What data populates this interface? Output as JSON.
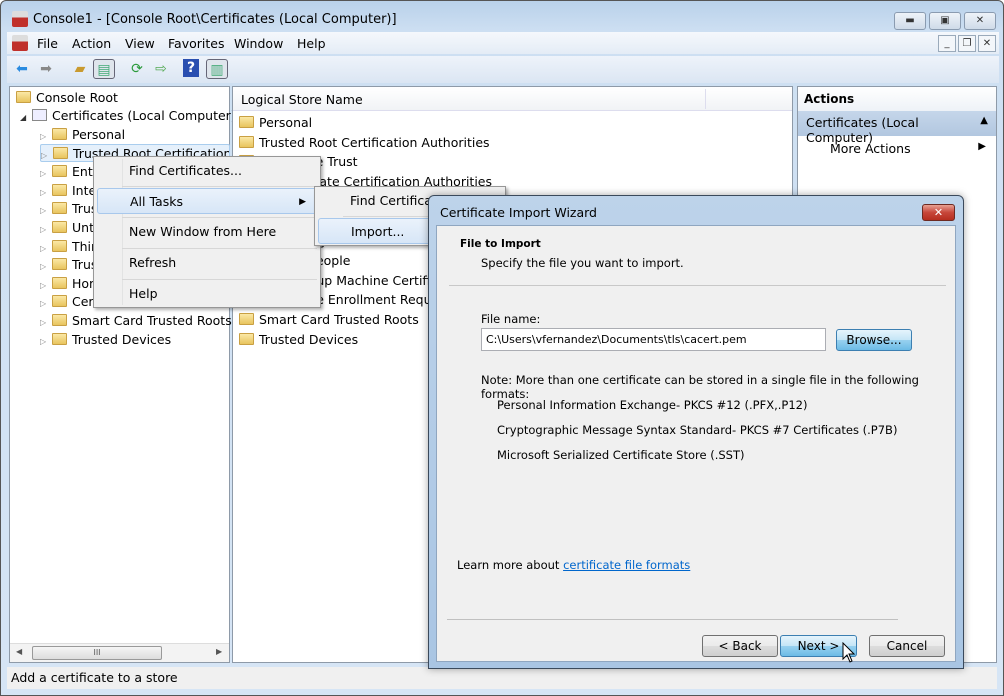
{
  "window": {
    "title": "Console1 - [Console Root\\Certificates (Local Computer)]",
    "controls": [
      "minimize",
      "maximize",
      "close"
    ]
  },
  "menubar": [
    "File",
    "Action",
    "View",
    "Favorites",
    "Window",
    "Help"
  ],
  "toolbar": [
    "back-icon",
    "forward-icon",
    "up-folder-icon",
    "show-hide-tree-icon",
    "refresh-icon",
    "export-list-icon",
    "help-icon",
    "show-hide-action-pane-icon"
  ],
  "tree": {
    "root": "Console Root",
    "certificates": "Certificates (Local Computer)",
    "items": [
      "Personal",
      "Trusted Root Certification Authorities",
      "Enterprise Trust",
      "Intermediate Certification Authorities",
      "Trusted Publishers",
      "Untrusted Certificates",
      "Third-Party Root Certification Authorities",
      "Trusted People",
      "Homegroup Machine Certificates",
      "Certificate Enrollment Requests",
      "Smart Card Trusted Roots",
      "Trusted Devices"
    ],
    "scroll_thumb": "III"
  },
  "list": {
    "column": "Logical Store Name",
    "items": [
      "Personal",
      "Trusted Root Certification Authorities",
      "Enterprise Trust",
      "Intermediate Certification Authorities",
      "Trusted Publishers",
      "Untrusted Certificates",
      "Third-Party Root Certification Authorities",
      "Trusted People",
      "Homegroup Machine Certificates",
      "Certificate Enrollment Requests",
      "Smart Card Trusted Roots",
      "Trusted Devices"
    ]
  },
  "actions": {
    "header": "Actions",
    "section": "Certificates (Local Computer)",
    "more": "More Actions"
  },
  "context_menu": {
    "items": [
      "Find Certificates...",
      "All Tasks",
      "New Window from Here",
      "Refresh",
      "Help"
    ],
    "submenu": [
      "Find Certificates...",
      "Import..."
    ]
  },
  "wizard": {
    "title": "Certificate Import Wizard",
    "heading": "File to Import",
    "subheading": "Specify the file you want to import.",
    "file_label": "File name:",
    "file_value": "C:\\Users\\vfernandez\\Documents\\tls\\cacert.pem",
    "browse": "Browse...",
    "note": "Note:  More than one certificate can be stored in a single file in the following formats:",
    "formats": [
      "Personal Information Exchange- PKCS #12 (.PFX,.P12)",
      "Cryptographic Message Syntax Standard- PKCS #7 Certificates (.P7B)",
      "Microsoft Serialized Certificate Store (.SST)"
    ],
    "learn_prefix": "Learn more about ",
    "learn_link": "certificate file formats",
    "back": "< Back",
    "next": "Next >",
    "cancel": "Cancel"
  },
  "status": "Add a certificate to a store",
  "colors": {
    "link": "#0066cc",
    "selection": "#d7e6f7",
    "close": "#c7463a"
  }
}
